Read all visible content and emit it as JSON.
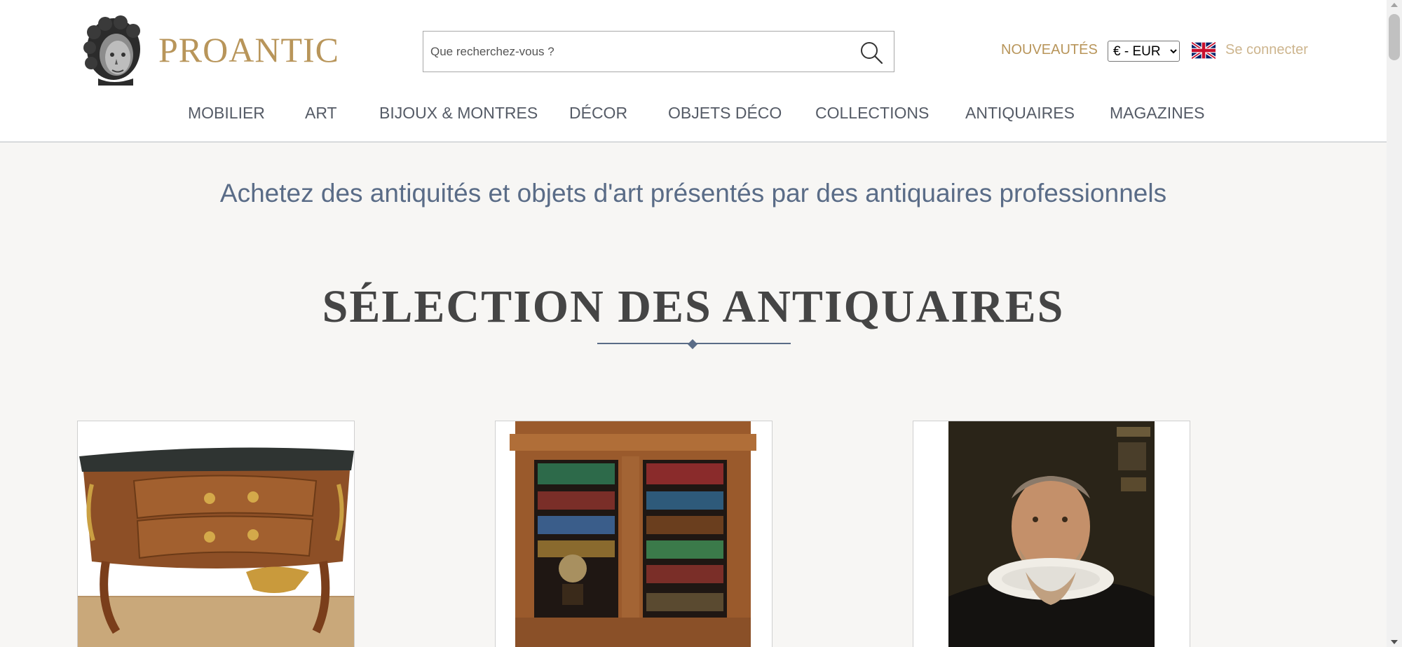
{
  "brand": {
    "name": "PROANTIC",
    "color": "#b8955a"
  },
  "search": {
    "placeholder": "Que recherchez-vous ?",
    "value": ""
  },
  "header": {
    "nouveautes_label": "NOUVEAUTÉS",
    "currency_selected": "€ - EUR",
    "language_flag": "uk-flag-icon",
    "login_label": "Se connecter"
  },
  "nav": {
    "items": [
      {
        "label": "MOBILIER"
      },
      {
        "label": "ART"
      },
      {
        "label": "BIJOUX & MONTRES"
      },
      {
        "label": "DÉCOR"
      },
      {
        "label": "OBJETS DÉCO"
      },
      {
        "label": "COLLECTIONS"
      },
      {
        "label": "ANTIQUAIRES"
      },
      {
        "label": "MAGAZINES"
      }
    ]
  },
  "main": {
    "tagline": "Achetez des antiquités et objets d'art présentés par des antiquaires professionnels",
    "section_title": "SÉLECTION DES ANTIQUAIRES",
    "cards": [
      {
        "image": "marquetry-commode-image"
      },
      {
        "image": "bookcase-image"
      },
      {
        "image": "portrait-painting-image"
      }
    ]
  },
  "colors": {
    "accent": "#b8955a",
    "text_blue": "#5a6c87",
    "nav_text": "#555b66",
    "bg": "#f7f6f4"
  }
}
